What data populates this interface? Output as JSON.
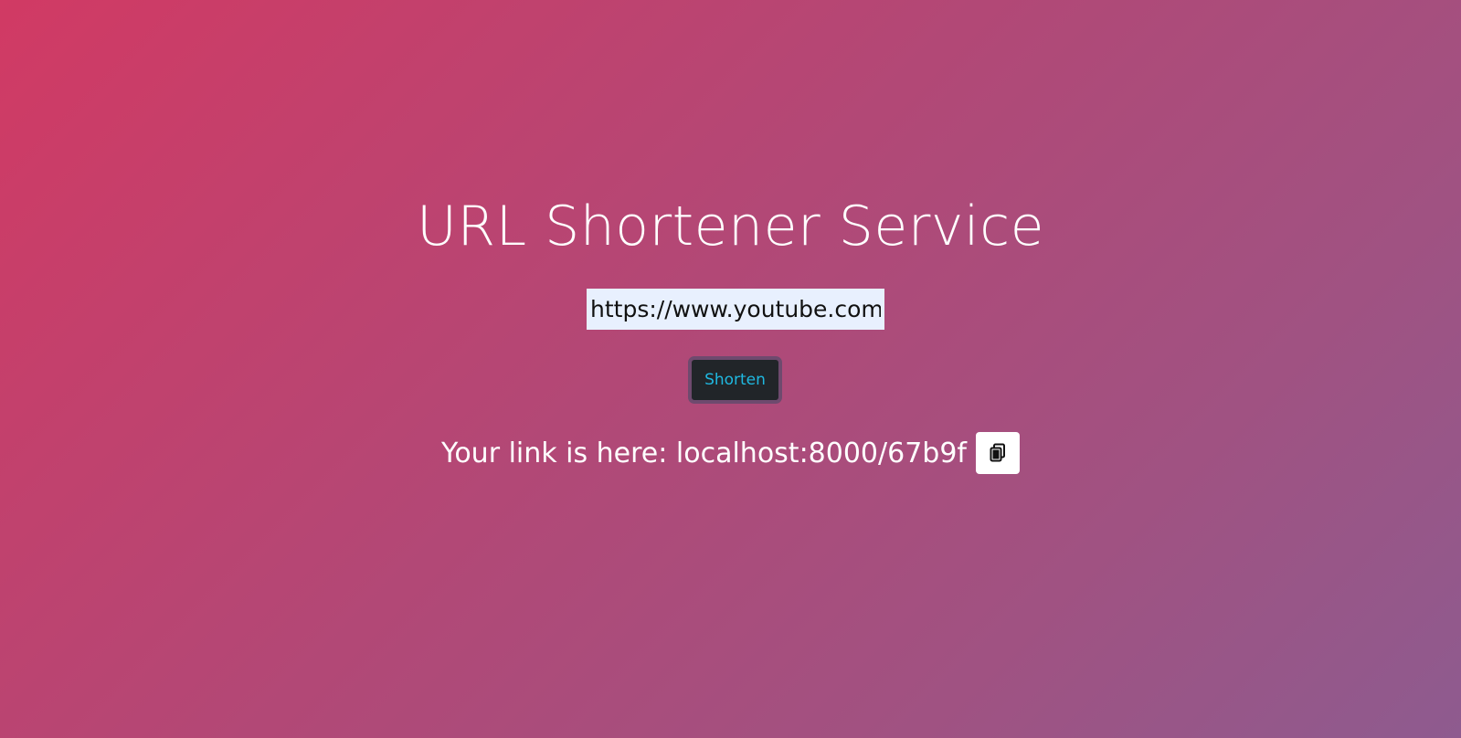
{
  "header": {
    "title": "URL Shortener Service"
  },
  "form": {
    "url_value": "https://www.youtube.com",
    "submit_label": "Shorten"
  },
  "result": {
    "text": "Your link is here: localhost:8000/67b9f",
    "copy_icon": "copy-icon"
  },
  "colors": {
    "gradient_start": "#d13a64",
    "gradient_end": "#8e5b8f",
    "button_bg": "#212529",
    "button_text": "#1fb8e0",
    "input_bg": "#e8f0fe"
  }
}
